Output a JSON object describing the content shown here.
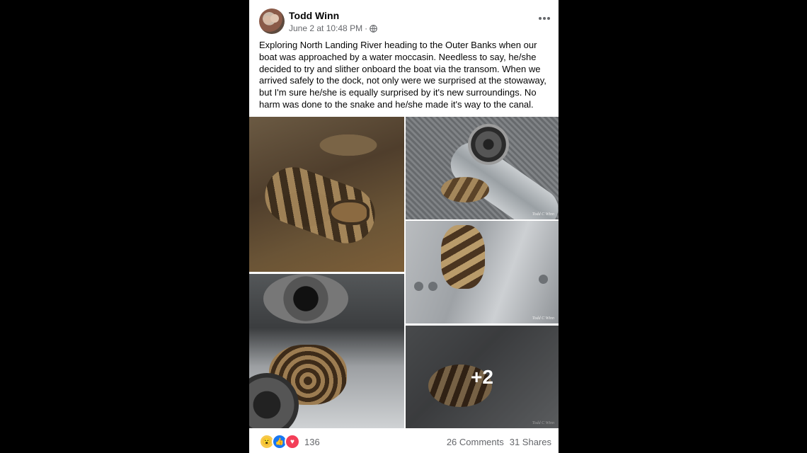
{
  "post": {
    "author": "Todd Winn",
    "timestamp": "June 2 at 10:48 PM",
    "separator": "·",
    "privacy_icon": "globe-icon",
    "text": "Exploring North Landing River heading to the Outer Banks when our boat was approached by a water moccasin. Needless to say, he/she decided to try and slither onboard the boat via the transom. When we arrived safely to the dock, not only were we surprised at the stowaway, but I'm sure he/she is equally surprised by it's new surroundings. No harm was done to the snake and he/she made it's way to the canal."
  },
  "photos": {
    "more_count": "+2"
  },
  "footer": {
    "reaction_icons": [
      "wow-icon",
      "like-icon",
      "love-icon"
    ],
    "reaction_count": "136",
    "comments": "26 Comments",
    "shares": "31 Shares"
  },
  "colors": {
    "like": "#1877f2",
    "love": "#f33e58",
    "wow": "#f7c94a",
    "secondary_text": "#65676b"
  }
}
